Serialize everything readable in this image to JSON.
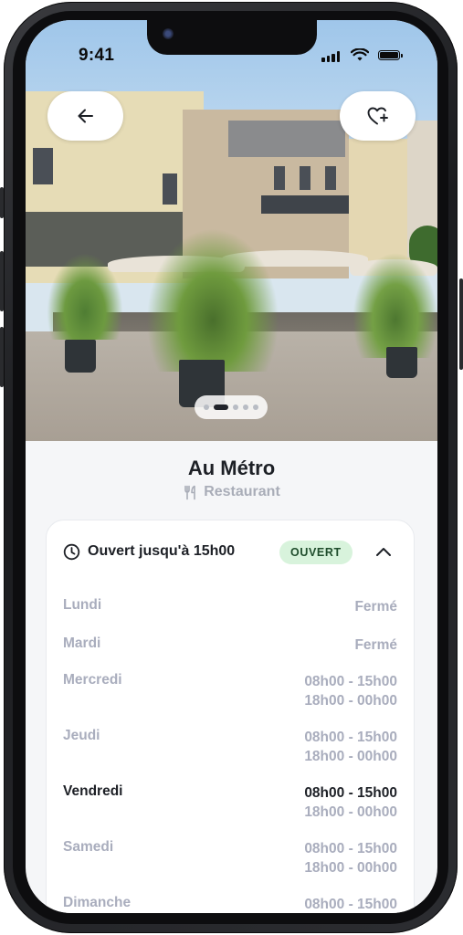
{
  "status_bar": {
    "time": "9:41"
  },
  "place": {
    "name": "Au Métro",
    "category": "Restaurant"
  },
  "gallery": {
    "pages": 5,
    "active_index": 1
  },
  "hours": {
    "summary": "Ouvert jusqu'à 15h00",
    "badge": "OUVERT",
    "days": [
      {
        "day": "Lundi",
        "line1": "Fermé",
        "line2": ""
      },
      {
        "day": "Mardi",
        "line1": "Fermé",
        "line2": ""
      },
      {
        "day": "Mercredi",
        "line1": "08h00 - 15h00",
        "line2": "18h00 - 00h00"
      },
      {
        "day": "Jeudi",
        "line1": "08h00 - 15h00",
        "line2": "18h00 - 00h00"
      },
      {
        "day": "Vendredi",
        "line1": "08h00 - 15h00",
        "line2": "18h00 - 00h00"
      },
      {
        "day": "Samedi",
        "line1": "08h00 - 15h00",
        "line2": "18h00 - 00h00"
      },
      {
        "day": "Dimanche",
        "line1": "08h00 - 15h00",
        "line2": ""
      }
    ]
  },
  "icons": {
    "back": "arrow-left-icon",
    "favorite": "heart-plus-icon",
    "category": "fork-knife-icon",
    "clock": "clock-icon",
    "collapse": "chevron-up-icon"
  },
  "colors": {
    "badge_bg": "#d8f3dc",
    "badge_text": "#1f4d2c",
    "muted": "#a9adbd",
    "text": "#1d2026"
  }
}
